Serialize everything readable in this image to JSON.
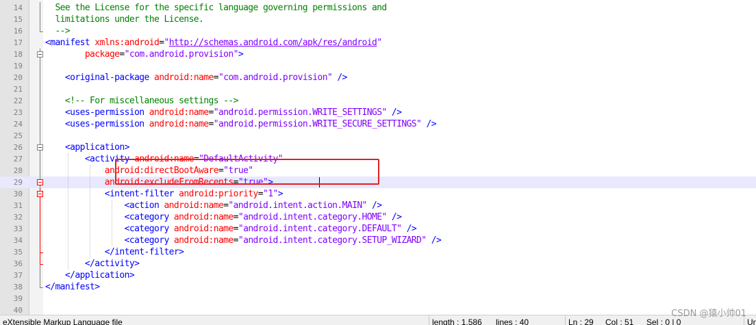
{
  "editor": {
    "language_status": "eXtensible Markup Language file",
    "length_status": "length : 1,586",
    "lines_status": "lines : 40",
    "ln_status": "Ln : 29",
    "col_status": "Col : 51",
    "sel_status": "Sel : 0 | 0",
    "encoding_status": "Un",
    "lines": [
      {
        "n": "14",
        "segs": [
          {
            "t": "  See the License for the specific language governing permissions and",
            "c": "comment"
          }
        ]
      },
      {
        "n": "15",
        "segs": [
          {
            "t": "  limitations under the License.",
            "c": "comment"
          }
        ]
      },
      {
        "n": "16",
        "segs": [
          {
            "t": "  -->",
            "c": "comment"
          }
        ]
      },
      {
        "n": "17",
        "segs": [
          {
            "t": "<manifest ",
            "c": "tag"
          },
          {
            "t": "xmlns:android",
            "c": "attr"
          },
          {
            "t": "=",
            "c": "eq"
          },
          {
            "t": "\"",
            "c": "str"
          },
          {
            "t": "http://schemas.android.com/apk/res/android",
            "c": "link"
          },
          {
            "t": "\"",
            "c": "str"
          }
        ]
      },
      {
        "n": "18",
        "segs": [
          {
            "t": "        package",
            "c": "attr"
          },
          {
            "t": "=",
            "c": "eq"
          },
          {
            "t": "\"com.android.provision\"",
            "c": "str"
          },
          {
            "t": ">",
            "c": "tag"
          }
        ]
      },
      {
        "n": "19",
        "segs": []
      },
      {
        "n": "20",
        "segs": [
          {
            "t": "    <original-package ",
            "c": "tag"
          },
          {
            "t": "android:name",
            "c": "attr"
          },
          {
            "t": "=",
            "c": "eq"
          },
          {
            "t": "\"com.android.provision\"",
            "c": "str"
          },
          {
            "t": " />",
            "c": "tag"
          }
        ]
      },
      {
        "n": "21",
        "segs": []
      },
      {
        "n": "22",
        "segs": [
          {
            "t": "    <!-- For miscellaneous settings -->",
            "c": "comment"
          }
        ]
      },
      {
        "n": "23",
        "segs": [
          {
            "t": "    <uses-permission ",
            "c": "tag"
          },
          {
            "t": "android:name",
            "c": "attr"
          },
          {
            "t": "=",
            "c": "eq"
          },
          {
            "t": "\"android.permission.WRITE_SETTINGS\"",
            "c": "str"
          },
          {
            "t": " />",
            "c": "tag"
          }
        ]
      },
      {
        "n": "24",
        "segs": [
          {
            "t": "    <uses-permission ",
            "c": "tag"
          },
          {
            "t": "android:name",
            "c": "attr"
          },
          {
            "t": "=",
            "c": "eq"
          },
          {
            "t": "\"android.permission.WRITE_SECURE_SETTINGS\"",
            "c": "str"
          },
          {
            "t": " />",
            "c": "tag"
          }
        ]
      },
      {
        "n": "25",
        "segs": []
      },
      {
        "n": "26",
        "segs": [
          {
            "t": "    <application>",
            "c": "tag"
          }
        ]
      },
      {
        "n": "27",
        "segs": [
          {
            "t": "        <activity ",
            "c": "tag"
          },
          {
            "t": "android:name",
            "c": "attr"
          },
          {
            "t": "=",
            "c": "eq"
          },
          {
            "t": "\"DefaultActivity\"",
            "c": "str"
          }
        ]
      },
      {
        "n": "28",
        "segs": [
          {
            "t": "            android:directBootAware",
            "c": "attr"
          },
          {
            "t": "=",
            "c": "eq"
          },
          {
            "t": "\"true\"",
            "c": "str"
          }
        ]
      },
      {
        "n": "29",
        "segs": [
          {
            "t": "            android:excludeFromRecents",
            "c": "attr"
          },
          {
            "t": "=",
            "c": "eq"
          },
          {
            "t": "\"true\"",
            "c": "str"
          },
          {
            "t": ">",
            "c": "tag"
          }
        ]
      },
      {
        "n": "30",
        "segs": [
          {
            "t": "            <intent-filter ",
            "c": "tag"
          },
          {
            "t": "android:priority",
            "c": "attr"
          },
          {
            "t": "=",
            "c": "eq"
          },
          {
            "t": "\"1\"",
            "c": "str"
          },
          {
            "t": ">",
            "c": "tag"
          }
        ]
      },
      {
        "n": "31",
        "segs": [
          {
            "t": "                <action ",
            "c": "tag"
          },
          {
            "t": "android:name",
            "c": "attr"
          },
          {
            "t": "=",
            "c": "eq"
          },
          {
            "t": "\"android.intent.action.MAIN\"",
            "c": "str"
          },
          {
            "t": " />",
            "c": "tag"
          }
        ]
      },
      {
        "n": "32",
        "segs": [
          {
            "t": "                <category ",
            "c": "tag"
          },
          {
            "t": "android:name",
            "c": "attr"
          },
          {
            "t": "=",
            "c": "eq"
          },
          {
            "t": "\"android.intent.category.HOME\"",
            "c": "str"
          },
          {
            "t": " />",
            "c": "tag"
          }
        ]
      },
      {
        "n": "33",
        "segs": [
          {
            "t": "                <category ",
            "c": "tag"
          },
          {
            "t": "android:name",
            "c": "attr"
          },
          {
            "t": "=",
            "c": "eq"
          },
          {
            "t": "\"android.intent.category.DEFAULT\"",
            "c": "str"
          },
          {
            "t": " />",
            "c": "tag"
          }
        ]
      },
      {
        "n": "34",
        "segs": [
          {
            "t": "                <category ",
            "c": "tag"
          },
          {
            "t": "android:name",
            "c": "attr"
          },
          {
            "t": "=",
            "c": "eq"
          },
          {
            "t": "\"android.intent.category.SETUP_WIZARD\"",
            "c": "str"
          },
          {
            "t": " />",
            "c": "tag"
          }
        ]
      },
      {
        "n": "35",
        "segs": [
          {
            "t": "            </intent-filter>",
            "c": "tag"
          }
        ]
      },
      {
        "n": "36",
        "segs": [
          {
            "t": "        </activity>",
            "c": "tag"
          }
        ]
      },
      {
        "n": "37",
        "segs": [
          {
            "t": "    </application>",
            "c": "tag"
          }
        ]
      },
      {
        "n": "38",
        "segs": [
          {
            "t": "</manifest>",
            "c": "tag"
          }
        ]
      },
      {
        "n": "39",
        "segs": []
      },
      {
        "n": "40",
        "segs": []
      }
    ]
  },
  "colors": {
    "tag": "#0000ff",
    "attr": "#ff0000",
    "string": "#8000ff",
    "comment": "#008000",
    "current_line": "#e8e8ff",
    "annotation_box": "#e02020"
  },
  "watermark": "CSDN @猿小帅01"
}
